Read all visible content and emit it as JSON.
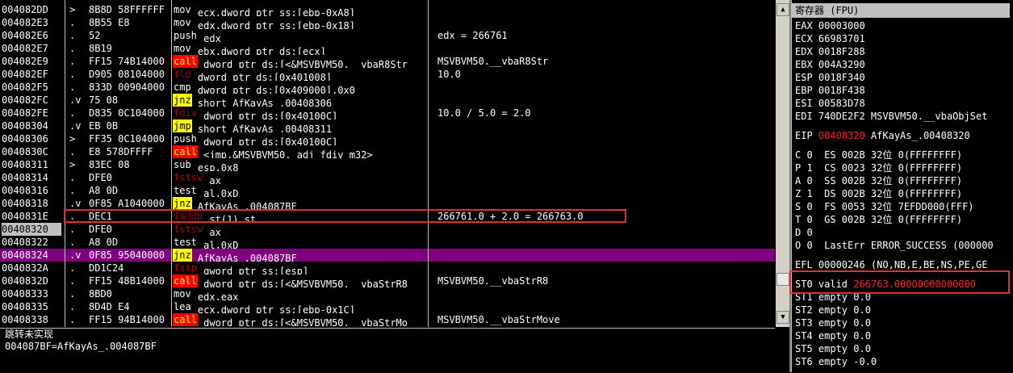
{
  "disasm": {
    "rows": [
      {
        "addr": "004082DD",
        "mark": ">",
        "hex": "8B8D 58FFFFFF",
        "mn": "mov",
        "cls": "m-mov",
        "ops": "ecx,dword ptr ss:[ebp-0xA8]",
        "cmt": ""
      },
      {
        "addr": "004082E3",
        "mark": ".",
        "hex": "8B55 E8",
        "mn": "mov",
        "cls": "m-mov",
        "ops": "edx,dword ptr ss:[ebp-0x18]",
        "cmt": ""
      },
      {
        "addr": "004082E6",
        "mark": ".",
        "hex": "52",
        "mn": "push",
        "cls": "m-push",
        "ops": "edx",
        "cmt": "edx = 266761"
      },
      {
        "addr": "004082E7",
        "mark": ".",
        "hex": "8B19",
        "mn": "mov",
        "cls": "m-mov",
        "ops": "ebx,dword ptr ds:[ecx]",
        "cmt": ""
      },
      {
        "addr": "004082E9",
        "mark": ".",
        "hex": "FF15 74B14000",
        "mn": "call",
        "cls": "m-call",
        "ops": "dword ptr ds:[<&MSVBVM50.__vbaR8Str",
        "cmt": "MSVBVM50.__vbaR8Str"
      },
      {
        "addr": "004082EF",
        "mark": ".",
        "hex": "D905 08104000",
        "mn": "fld",
        "cls": "m-fpu",
        "ops": "dword ptr ds:[0x401008]",
        "cmt": "10.0"
      },
      {
        "addr": "004082F5",
        "mark": ".",
        "hex": "833D 00904000",
        "mn": "cmp",
        "cls": "m-cmp",
        "ops": "dword ptr ds:[0x409000],0x0",
        "cmt": ""
      },
      {
        "addr": "004082FC",
        "mark": ".v",
        "hex": "75 08",
        "mn": "jnz",
        "cls": "m-jmp",
        "ops": "short AfKayAs_.00408306",
        "cmt": ""
      },
      {
        "addr": "004082FE",
        "mark": ".",
        "hex": "D835 0C104000",
        "mn": "fdiv",
        "cls": "m-fpu",
        "ops": "dword ptr ds:[0x40100C]",
        "cmt": "10.0 / 5.0 = 2.0"
      },
      {
        "addr": "00408304",
        "mark": ".v",
        "hex": "EB 0B",
        "mn": "jmp",
        "cls": "m-jmp",
        "ops": "short AfKayAs_.00408311",
        "cmt": ""
      },
      {
        "addr": "00408306",
        "mark": ">",
        "hex": "FF35 0C104000",
        "mn": "push",
        "cls": "m-push",
        "ops": "dword ptr ds:[0x40100C]",
        "cmt": ""
      },
      {
        "addr": "0040830C",
        "mark": ".",
        "hex": "E8 578DFFFF",
        "mn": "call",
        "cls": "m-call",
        "ops": "<jmp.&MSVBVM50._adj_fdiv_m32>",
        "cmt": ""
      },
      {
        "addr": "00408311",
        "mark": ">",
        "hex": "83EC 08",
        "mn": "sub",
        "cls": "m-mov",
        "ops": "esp,0x8",
        "cmt": ""
      },
      {
        "addr": "00408314",
        "mark": ".",
        "hex": "DFE0",
        "mn": "fstsw",
        "cls": "m-fpu",
        "ops": "ax",
        "cmt": ""
      },
      {
        "addr": "00408316",
        "mark": ".",
        "hex": "A8 0D",
        "mn": "test",
        "cls": "m-mov",
        "ops": "al,0xD",
        "cmt": ""
      },
      {
        "addr": "00408318",
        "mark": ".v",
        "hex": "0F85 A1040000",
        "mn": "jnz",
        "cls": "m-jmp",
        "ops": "AfKayAs_.004087BF",
        "cmt": ""
      },
      {
        "addr": "0040831E",
        "mark": ".",
        "hex": "DEC1",
        "mn": "faddp",
        "cls": "m-fpu",
        "ops": "st(1),st",
        "cmt": "266761.0 + 2.0 = 266763.0"
      },
      {
        "addr": "00408320",
        "mark": ".",
        "hex": "DFE0",
        "mn": "fstsw",
        "cls": "m-fpu",
        "ops": "ax",
        "cmt": ""
      },
      {
        "addr": "00408322",
        "mark": ".",
        "hex": "A8 0D",
        "mn": "test",
        "cls": "m-mov",
        "ops": "al,0xD",
        "cmt": ""
      },
      {
        "addr": "00408324",
        "mark": ".v",
        "hex": "0F85 95040000",
        "mn": "jnz",
        "cls": "m-jmp",
        "ops": "AfKayAs_.004087BF",
        "cmt": ""
      },
      {
        "addr": "0040832A",
        "mark": ".",
        "hex": "DD1C24",
        "mn": "fstp",
        "cls": "m-fpu",
        "ops": "qword ptr ss:[esp]",
        "cmt": ""
      },
      {
        "addr": "0040832D",
        "mark": ".",
        "hex": "FF15 48B14000",
        "mn": "call",
        "cls": "m-call",
        "ops": "dword ptr ds:[<&MSVBVM50.__vbaStrR8",
        "cmt": "MSVBVM50.__vbaStrR8"
      },
      {
        "addr": "00408333",
        "mark": ".",
        "hex": "8BD0",
        "mn": "mov",
        "cls": "m-mov",
        "ops": "edx,eax",
        "cmt": ""
      },
      {
        "addr": "00408335",
        "mark": ".",
        "hex": "8D4D E4",
        "mn": "lea",
        "cls": "m-mov",
        "ops": "ecx,dword ptr ss:[ebp-0x1C]",
        "cmt": ""
      },
      {
        "addr": "00408338",
        "mark": ".",
        "hex": "FF15 94B14000",
        "mn": "call",
        "cls": "m-call",
        "ops": "dword ptr ds:[<&MSVBVM50.__vbaStrMo",
        "cmt": "MSVBVM50.__vbaStrMove"
      }
    ]
  },
  "info": {
    "line1": "跳转未实现",
    "line2": "004087BF=AfKayAs_.004087BF"
  },
  "registers": {
    "title": "寄存器 (FPU)",
    "gp": [
      "EAX 00003000",
      "ECX 66983701",
      "EDX 0018F288",
      "EBX 004A3290",
      "ESP 0018F340",
      "EBP 0018F438",
      "ESI 00583D78",
      "EDI 740DE2F2 MSVBVM50.__vbaObjSet"
    ],
    "eip_label": "EIP",
    "eip_value": "00408320",
    "eip_sym": "AfKayAs_.00408320",
    "flags": [
      "C 0  ES 002B 32位 0(FFFFFFFF)",
      "P 1  CS 0023 32位 0(FFFFFFFF)",
      "A 0  SS 002B 32位 0(FFFFFFFF)",
      "Z 1  DS 002B 32位 0(FFFFFFFF)",
      "S 0  FS 0053 32位 7EFDD000(FFF)",
      "T 0  GS 002B 32位 0(FFFFFFFF)",
      "D 0",
      "O 0  LastErr ERROR_SUCCESS (000000"
    ],
    "efl": "EFL 00000246 (NO,NB,E,BE,NS,PE,GE",
    "st0_label": "ST0 valid",
    "st0_value": "266763.00000000000000",
    "fpu": [
      "ST1 empty 0.0",
      "ST2 empty 0.0",
      "ST3 empty 0.0",
      "ST4 empty 0.0",
      "ST5 empty 0.0",
      "ST6 empty -0.0"
    ]
  }
}
